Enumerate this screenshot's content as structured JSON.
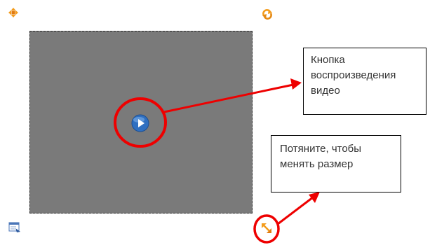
{
  "widget": {
    "move_handle_icon": "four-way-move-icon",
    "rotate_handle_icon": "rotate-icon",
    "play_button_icon": "play-icon",
    "resize_handle_icon": "resize-corner-icon",
    "settings_icon": "edit-panel-icon"
  },
  "callouts": {
    "play_button": {
      "lines": [
        "Кнопка",
        "воспроизведения",
        "видео"
      ]
    },
    "resize": {
      "lines": [
        "Потяните, чтобы",
        "менять размер"
      ]
    }
  },
  "colors": {
    "annotation_red": "#ee0000",
    "handle_orange": "#f39c1c",
    "video_area_gray": "#7a7a7a",
    "play_button_blue": "#2f6fc0"
  }
}
